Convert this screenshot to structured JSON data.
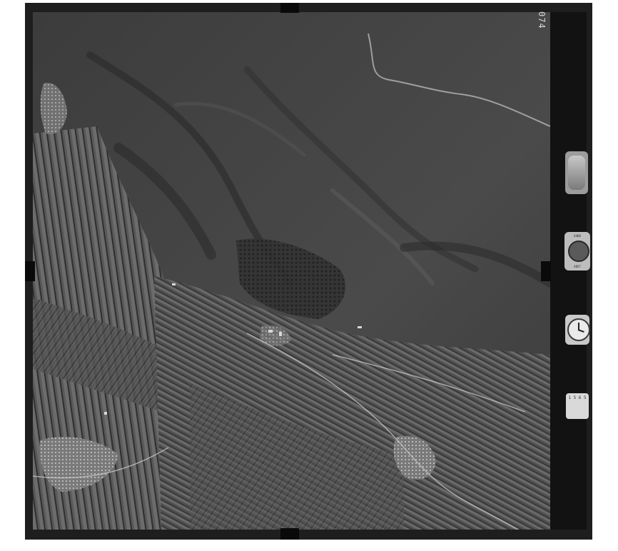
{
  "frame": {
    "number": "074",
    "background": "#1e1e1e"
  },
  "photo": {
    "subject": "aerial-photograph",
    "tone": "grayscale"
  },
  "instruments": {
    "level": {
      "icon": "level-bubble-icon"
    },
    "altimeter": {
      "icon": "altimeter-icon",
      "top_text": "6460",
      "bottom_text": "4057"
    },
    "clock": {
      "icon": "clock-icon"
    },
    "date": {
      "icon": "date-counter-icon",
      "text": "1 5 6 5"
    }
  }
}
